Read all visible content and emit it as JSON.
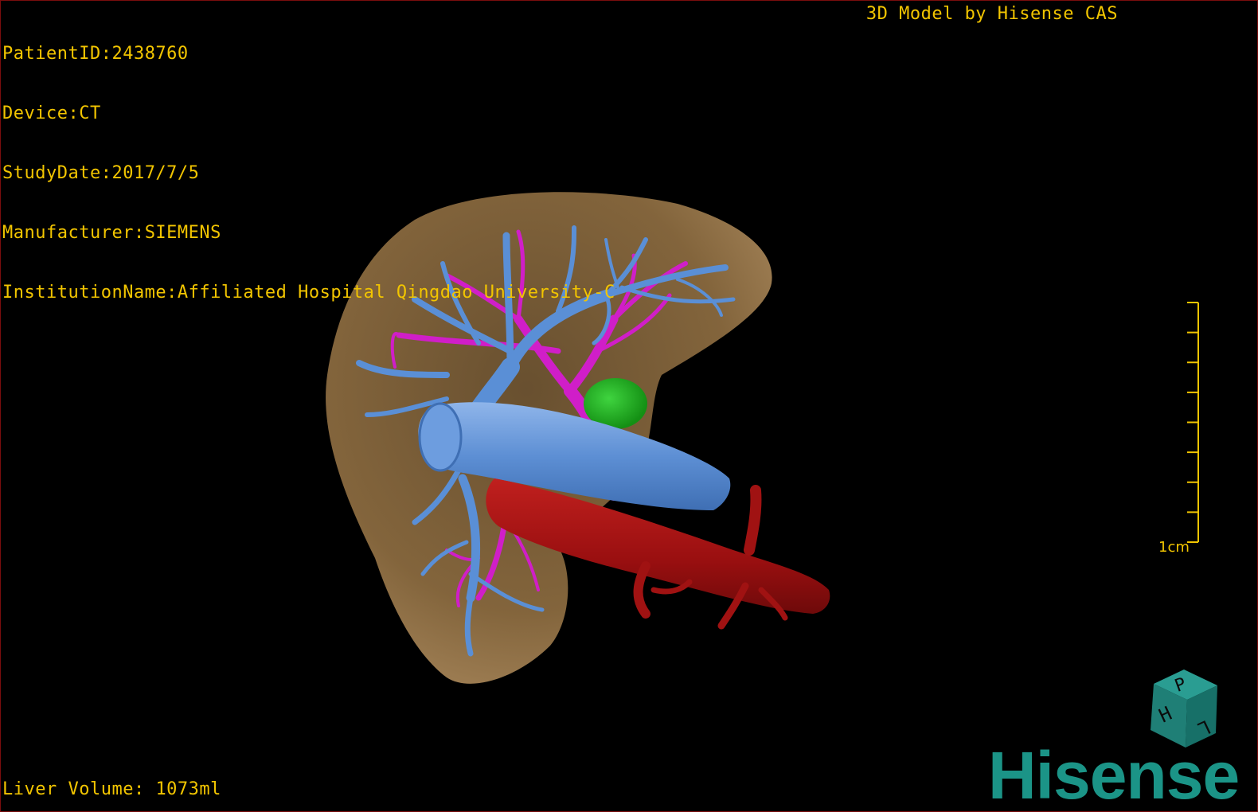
{
  "header": {
    "patient_id_label": "PatientID:",
    "patient_id": "2438760",
    "device_label": "Device:",
    "device": "CT",
    "study_date_label": "StudyDate:",
    "study_date": "2017/7/5",
    "manufacturer_label": "Manufacturer:",
    "manufacturer": "SIEMENS",
    "institution_label": "InstitutionName:",
    "institution": "Affiliated Hospital Qingdao University-C",
    "brand_text": "3D Model by Hisense CAS"
  },
  "footer": {
    "volume_label": "Liver Volume: ",
    "volume_value": "1073ml"
  },
  "scale_bar": {
    "label": "1cm",
    "ticks": 9
  },
  "orientation_cube": {
    "faces": [
      "P",
      "H",
      "L"
    ]
  },
  "logo": {
    "text": "Hisense"
  },
  "colors": {
    "overlay_text": "#f2c500",
    "liver": "#8a6a3f",
    "portal_vein": "#5a8fd6",
    "hepatic_artery": "#d01ec8",
    "inferior_vena_cava": "#c43d3d",
    "lesion": "#1db81d",
    "logo": "#1b9487",
    "border": "#7a0d0d"
  },
  "model_structures": [
    "liver",
    "portal-vein",
    "hepatic-artery",
    "vena-cava",
    "lesion"
  ]
}
